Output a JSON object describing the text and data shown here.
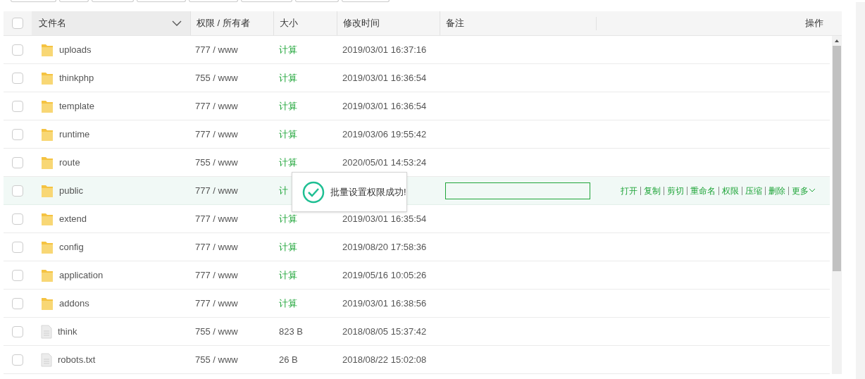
{
  "table": {
    "select_all": {
      "checked": false
    },
    "columns": [
      {
        "label": "文件名",
        "sortable": true
      },
      {
        "label": "权限 / 所有者"
      },
      {
        "label": "大小"
      },
      {
        "label": "修改时间"
      },
      {
        "label": "备注"
      },
      {
        "label": "操作"
      }
    ],
    "rows": [
      {
        "kind": "folder",
        "name": "uploads",
        "perms": "777 / www",
        "size": "计算",
        "mtime": "2019/03/01 16:37:16",
        "checked": false,
        "selected": false
      },
      {
        "kind": "folder",
        "name": "thinkphp",
        "perms": "755 / www",
        "size": "计算",
        "mtime": "2019/03/01 16:36:54",
        "checked": false,
        "selected": false
      },
      {
        "kind": "folder",
        "name": "template",
        "perms": "777 / www",
        "size": "计算",
        "mtime": "2019/03/01 16:36:54",
        "checked": false,
        "selected": false
      },
      {
        "kind": "folder",
        "name": "runtime",
        "perms": "777 / www",
        "size": "计算",
        "mtime": "2019/03/06 19:55:42",
        "checked": false,
        "selected": false
      },
      {
        "kind": "folder",
        "name": "route",
        "perms": "755 / www",
        "size": "计算",
        "mtime": "2020/05/01 14:53:24",
        "checked": false,
        "selected": false
      },
      {
        "kind": "folder",
        "name": "public",
        "perms": "777 / www",
        "size": "计",
        "checked": false,
        "selected": true,
        "actions": [
          "打开",
          "复制",
          "剪切",
          "重命名",
          "权限",
          "压缩",
          "删除",
          "更多"
        ]
      },
      {
        "kind": "folder",
        "name": "extend",
        "perms": "777 / www",
        "size": "计算",
        "mtime": "2019/03/01 16:35:54",
        "checked": false,
        "selected": false
      },
      {
        "kind": "folder",
        "name": "config",
        "perms": "777 / www",
        "size": "计算",
        "mtime": "2019/08/20 17:58:36",
        "checked": false,
        "selected": false
      },
      {
        "kind": "folder",
        "name": "application",
        "perms": "777 / www",
        "size": "计算",
        "mtime": "2019/05/16 10:05:26",
        "checked": false,
        "selected": false
      },
      {
        "kind": "folder",
        "name": "addons",
        "perms": "777 / www",
        "size": "计算",
        "mtime": "2019/03/01 16:38:56",
        "checked": false,
        "selected": false
      },
      {
        "kind": "file",
        "name": "think",
        "perms": "755 / www",
        "size": "823 B",
        "mtime": "2018/08/05 15:37:42",
        "checked": false,
        "selected": false
      },
      {
        "kind": "file",
        "name": "robots.txt",
        "perms": "755 / www",
        "size": "26 B",
        "mtime": "2018/08/22 15:02:08",
        "checked": false,
        "selected": false
      }
    ]
  },
  "toast": {
    "message": "批量设置权限成功!"
  }
}
